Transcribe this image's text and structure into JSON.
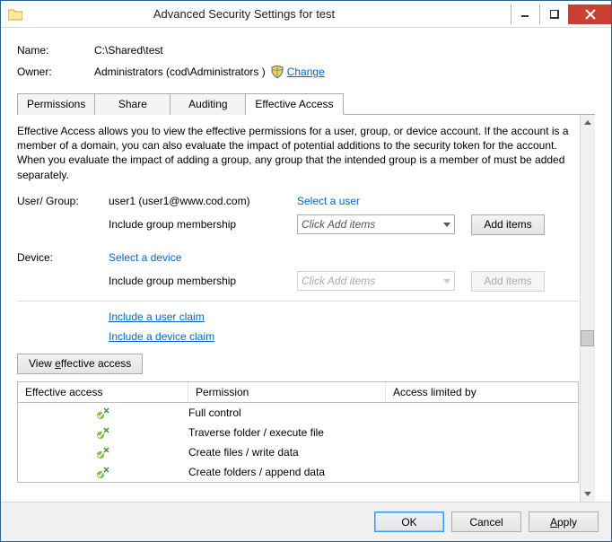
{
  "window": {
    "title": "Advanced Security Settings for test"
  },
  "header": {
    "name_label": "Name:",
    "name_value": "C:\\Shared\\test",
    "owner_label": "Owner:",
    "owner_value": "Administrators (cod\\Administrators  )",
    "change_link": "Change"
  },
  "tabs": {
    "permissions": "Permissions",
    "share": "Share",
    "auditing": "Auditing",
    "effective": "Effective Access"
  },
  "description": "Effective Access allows you to view the effective permissions for a user, group, or device account. If the account is a member of a domain, you can also evaluate the impact of potential additions to the security token for the account. When you evaluate the impact of adding a group, any group that the intended group is a member of must be added separately.",
  "usergroup": {
    "label": "User/ Group:",
    "value": "user1 (user1@www.cod.com)",
    "select_link": "Select a user",
    "include_label": "Include group membership",
    "select_placeholder": "Click Add items",
    "add_btn": "Add items"
  },
  "device": {
    "label": "Device:",
    "select_link": "Select a device",
    "include_label": "Include group membership",
    "select_placeholder": "Click Add items",
    "add_btn": "Add items"
  },
  "claims": {
    "user": "Include a user claim",
    "device": "Include a device claim"
  },
  "view_btn": "View effective access",
  "table": {
    "col_effective": "Effective access",
    "col_permission": "Permission",
    "col_limited": "Access limited by",
    "rows": [
      {
        "permission": "Full control"
      },
      {
        "permission": "Traverse folder / execute file"
      },
      {
        "permission": "Create files / write data"
      },
      {
        "permission": "Create folders / append data"
      }
    ]
  },
  "footer": {
    "ok": "OK",
    "cancel": "Cancel",
    "apply": "Apply"
  }
}
